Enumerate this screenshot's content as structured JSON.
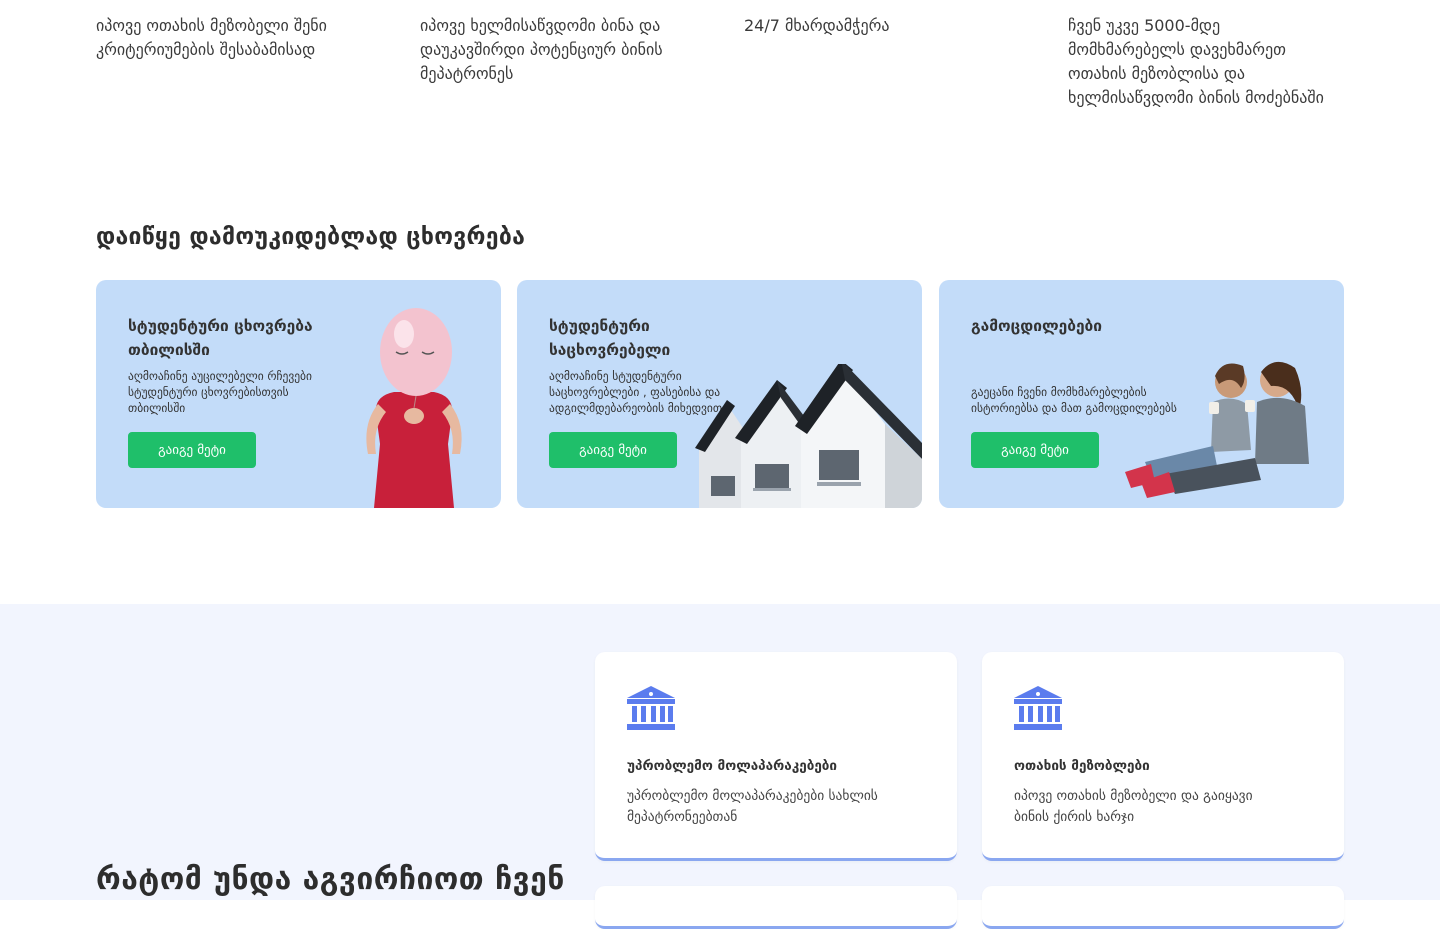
{
  "features": [
    "იპოვე ოთახის მეზობელი შენი კრიტერიუმების შესაბამისად",
    "იპოვე ხელმისაწვდომი ბინა და დაუკავშირდი პოტენციურ ბინის მეპატრონეს",
    "24/7 მხარდამჭერა",
    "ჩვენ უკვე 5000-მდე მომხმარებელს დავეხმარეთ ოთახის მეზობლისა და ხელმისაწვდომი ბინის მოძებნაში"
  ],
  "section_title": "დაიწყე დამოუკიდებლად ცხოვრება",
  "cards": [
    {
      "title": "სტუდენტური ცხოვრება თბილისში",
      "desc": "აღმოაჩინე აუცილებელი რჩევები სტუდენტური ცხოვრებისთვის თბილისში",
      "button": "გაიგე მეტი",
      "image_icon": "balloon-person-illustration"
    },
    {
      "title": "სტუდენტური საცხოვრებელი",
      "desc": "აღმოაჩინე სტუდენტური საცხოვრებლები , ფასებისა და ადგილმდებარეობის მიხედვით",
      "button": "გაიგე მეტი",
      "image_icon": "houses-illustration"
    },
    {
      "title": "გამოცდილებები",
      "desc": "გაეცანი ჩვენი მომხმარებლების ისტორიებსა და მათ გამოცდილებებს",
      "button": "გაიგე მეტი",
      "image_icon": "two-women-illustration"
    }
  ],
  "why": {
    "title": "რატომ უნდა აგვირჩიოთ ჩვენ",
    "items": [
      {
        "icon": "bank-icon",
        "title": "უპრობლემო მოლაპარაკებები",
        "text": "უპრობლემო მოლაპარაკებები სახლის მეპატრონეებთან"
      },
      {
        "icon": "bank-icon",
        "title": "ოთახის მეზობლები",
        "text": "იპოვე ოთახის მეზობელი და გაიყავი ბინის ქირის ხარჯი"
      }
    ]
  },
  "colors": {
    "card_bg": "#c3dcf9",
    "button_green": "#1fbf6a",
    "why_bg": "#f2f5fe",
    "icon_blue": "#5b7cee"
  }
}
